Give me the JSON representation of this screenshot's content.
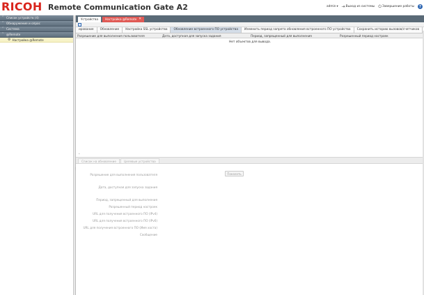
{
  "header": {
    "logo": "RICOH",
    "title": "Remote Communication Gate A2",
    "user": "admin",
    "logout": "Выход из системы",
    "shutdown": "Завершение работы",
    "help": "?"
  },
  "sidebar": {
    "sections": [
      {
        "label": "Список устройств (4)"
      },
      {
        "label": "Обнаружение и опрос"
      },
      {
        "label": "Система"
      },
      {
        "label": "@Remote",
        "expanded": true
      }
    ],
    "sub_items": [
      {
        "label": "Настройка @Remote"
      }
    ]
  },
  "tabs": [
    {
      "label": "Устройства",
      "active": false
    },
    {
      "label": "Настройка @Remote",
      "active": true
    }
  ],
  "actions": [
    "ирование",
    "Обновление",
    "Настройка SSL устройства",
    "Обновление встроенного ПО устройства",
    "Изменить период запрета обновления встроенного ПО устройства",
    "Сохранить историю вызовов/счетчиков"
  ],
  "active_action_index": 3,
  "columns": [
    "Разрешение для выполнения пользователя",
    "Дата, доступная для запуска задания",
    "Период, запрещенный для выполнения",
    "Разрешенный период настроек"
  ],
  "empty_message": "Нет объектов для вывода.",
  "detail_tabs": [
    "Список на обновление",
    "Целевые устройства"
  ],
  "detail": {
    "show_button": "Показать",
    "labels": [
      "Разрешение для выполнения пользователя",
      "Дата, доступная для запуска задания",
      "Период, запрещенный для выполнения",
      "Разрешенный период настроек",
      "URL для получения встроенного ПО (IPv4)",
      "URL для получения встроенного ПО (IPv6)",
      "URL для получения встроенного ПО (Имя хоста)",
      "Сообщение"
    ]
  },
  "colors": {
    "brand_red": "#d9241c",
    "active_tab": "#e05a55",
    "tab_bar": "#5a6a77",
    "sidebar_header": "#6e7e8c",
    "selected_item": "#f7f3c8"
  },
  "icons": [
    "chevron-up-icon",
    "chevron-down-icon",
    "gear-icon",
    "logout-icon",
    "power-icon",
    "help-icon",
    "close-icon",
    "toolbar-list-icon"
  ]
}
